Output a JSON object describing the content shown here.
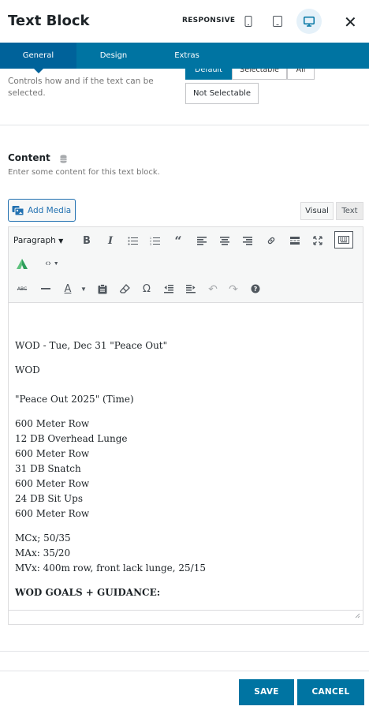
{
  "header": {
    "title": "Text Block",
    "responsive_label": "RESPONSIVE",
    "devices": [
      {
        "name": "phone-icon"
      },
      {
        "name": "tablet-icon"
      },
      {
        "name": "desktop-icon",
        "active": true
      }
    ],
    "close_icon": "close-icon"
  },
  "tabs": [
    {
      "label": "General",
      "active": true
    },
    {
      "label": "Design",
      "active": false
    },
    {
      "label": "Extras",
      "active": false
    }
  ],
  "selectable": {
    "help": "Controls how and if the text can be selected.",
    "options": [
      "Default",
      "Selectable",
      "All"
    ],
    "selected": "Default",
    "not_selectable": "Not Selectable"
  },
  "content": {
    "label": "Content",
    "description": "Enter some content for this text block.",
    "add_media": "Add Media",
    "view_tabs": [
      "Visual",
      "Text"
    ],
    "active_view": "Visual",
    "format_select": "Paragraph",
    "body": {
      "line1": "WOD - Tue, Dec 31 \"Peace Out\"",
      "line2": "WOD",
      "line3": "\"Peace Out 2025\" (Time)",
      "workout": [
        "600 Meter Row",
        "12 DB Overhead Lunge",
        "600 Meter Row",
        "31 DB Snatch",
        "600 Meter Row",
        "24 DB Sit Ups",
        "600 Meter Row"
      ],
      "scales": [
        "MCx; 50/35",
        "MAx: 35/20",
        "MVx: 400m row, front lack lunge, 25/15"
      ],
      "goals": "WOD GOALS + GUIDANCE:"
    }
  },
  "colors": {
    "accent": "#0074a2",
    "active_tab": "#00629a"
  },
  "footer": {
    "save": "SAVE",
    "cancel": "CANCEL"
  }
}
